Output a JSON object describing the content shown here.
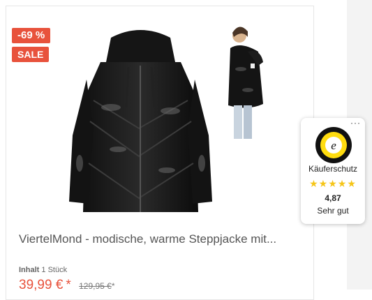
{
  "product": {
    "discount_badge": "-69 %",
    "sale_badge": "SALE",
    "title": "ViertelMond - modische, warme Steppjacke mit...",
    "content_label": "Inhalt",
    "content_value": "1 Stück",
    "price": "39,99 €",
    "price_star": "*",
    "old_price": "129,95 €",
    "old_price_star": "*",
    "main_image_icon": "jacket-image",
    "thumb_image_icon": "model-photo"
  },
  "trust_widget": {
    "more_label": "···",
    "seal_icon": "trusted-shops-seal",
    "title": "Käuferschutz",
    "stars": "★★★★★",
    "score": "4,87",
    "verdict": "Sehr gut"
  },
  "colors": {
    "accent": "#e8523c",
    "star": "#f5c518",
    "seal": "#ffdc0f"
  }
}
